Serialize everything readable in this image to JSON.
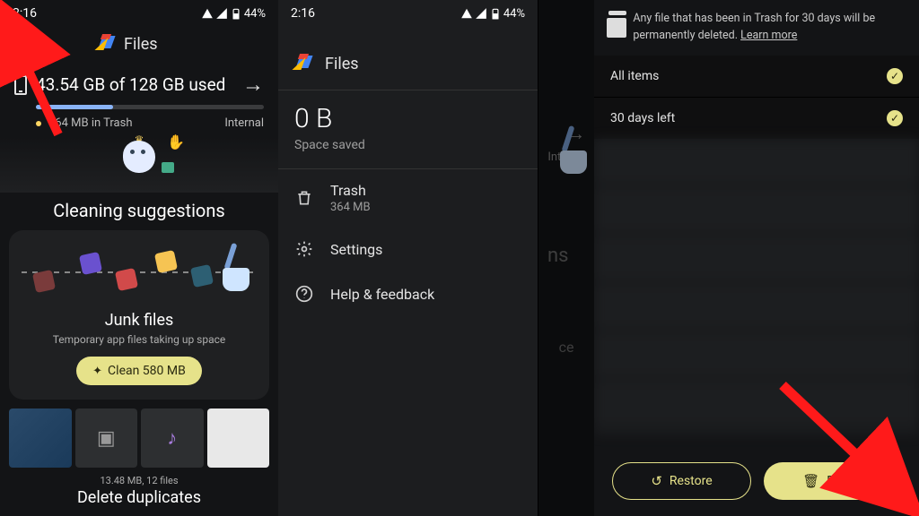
{
  "status": {
    "time": "2:16",
    "battery": "44%"
  },
  "app": {
    "title": "Files"
  },
  "panel1": {
    "storage_text": "43.54 GB of 128 GB used",
    "trash_line": "364 MB in Trash",
    "storage_label": "Internal",
    "section_title": "Cleaning suggestions",
    "junk": {
      "title": "Junk files",
      "subtitle": "Temporary app files taking up space",
      "button": "Clean 580 MB"
    },
    "duplicates": {
      "meta": "13.48 MB, 12 files",
      "title": "Delete duplicates"
    }
  },
  "panel2": {
    "space_value": "0 B",
    "space_label": "Space saved",
    "items": [
      {
        "label": "Trash",
        "sub": "364 MB"
      },
      {
        "label": "Settings"
      },
      {
        "label": "Help & feedback"
      }
    ],
    "bg_label": "Internal",
    "bg_ns": "ns"
  },
  "panel3": {
    "banner": "Any file that has been in Trash for 30 days will be permanently deleted.",
    "banner_link": "Learn more",
    "rows": [
      {
        "label": "All items"
      },
      {
        "label": "30 days left"
      }
    ],
    "restore": "Restore",
    "delete": "Delete"
  }
}
